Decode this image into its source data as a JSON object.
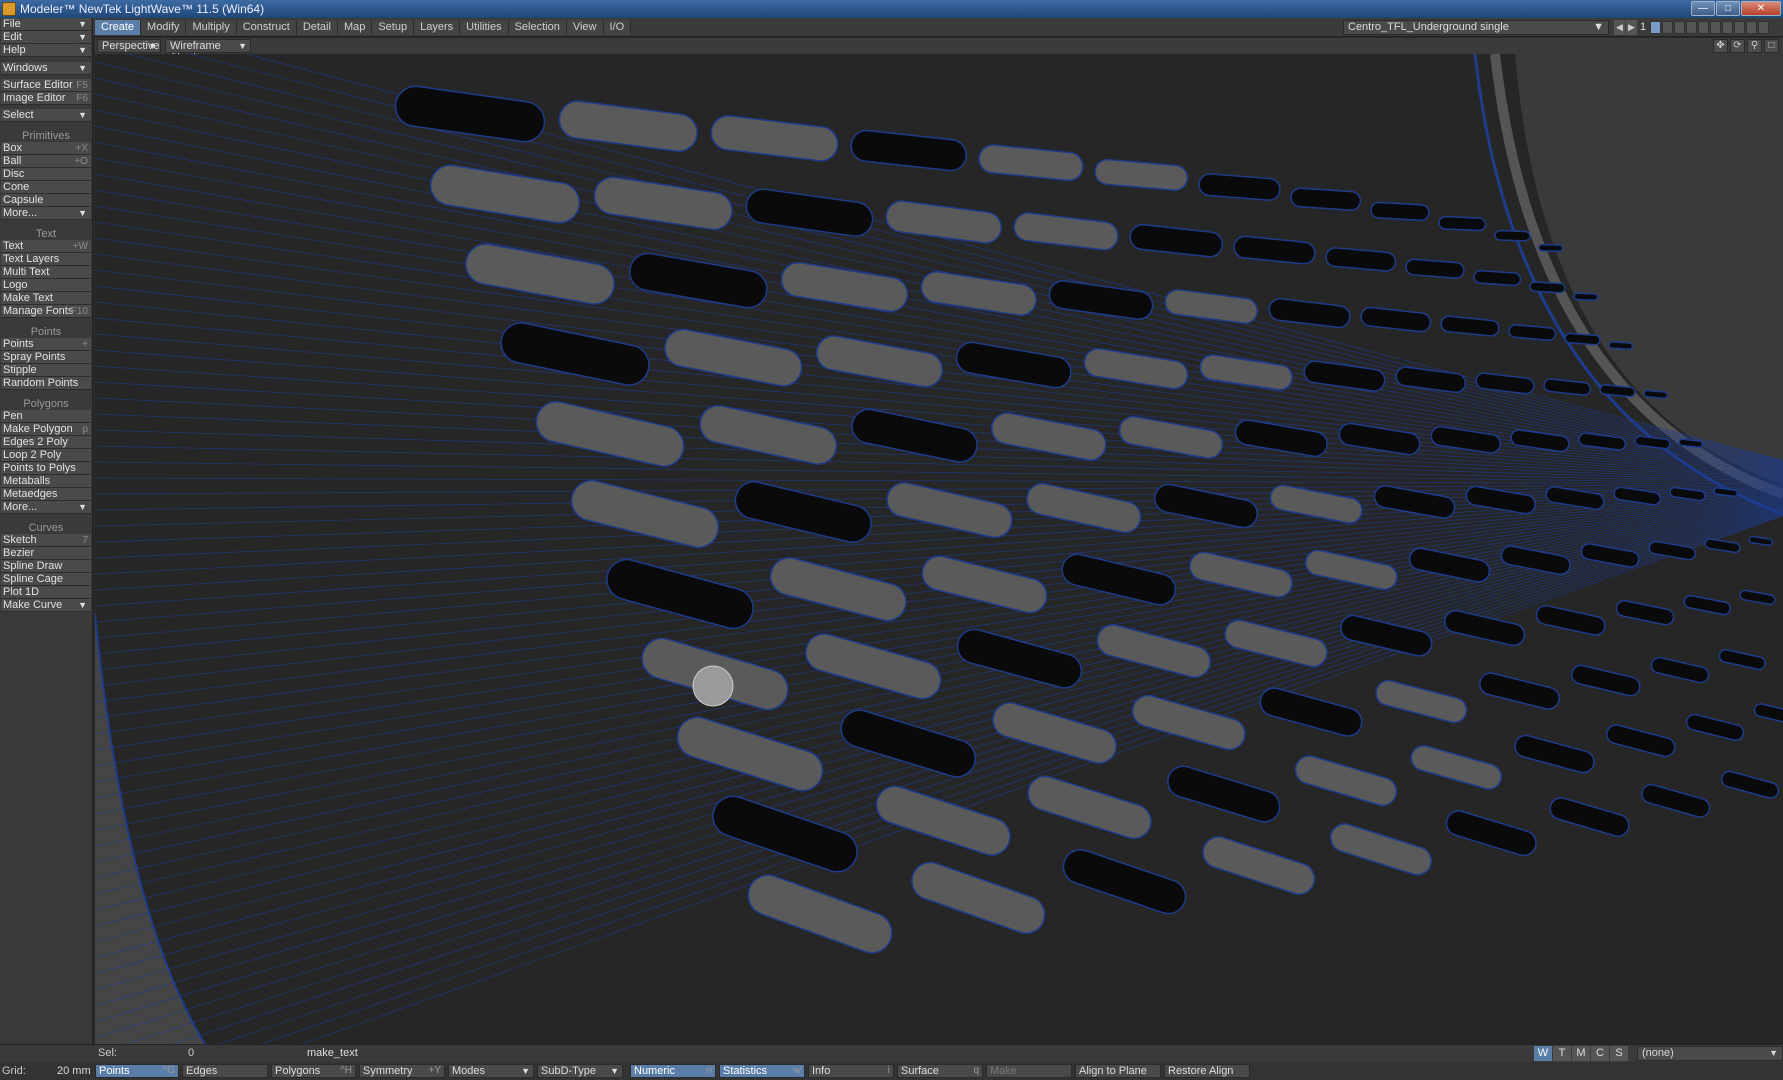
{
  "window": {
    "title": "Modeler™ NewTek LightWave™ 11.5 (Win64)"
  },
  "tabs": [
    "Create",
    "Modify",
    "Multiply",
    "Construct",
    "Detail",
    "Map",
    "Setup",
    "Layers",
    "Utilities",
    "Selection",
    "View",
    "I/O"
  ],
  "active_tab": "Create",
  "object_select": "Centro_TFL_Underground single",
  "layer_number": "1",
  "toolbar": {
    "file": "File",
    "edit": "Edit",
    "help": "Help",
    "windows": "Windows",
    "surface_editor": "Surface Editor",
    "surface_editor_key": "F5",
    "image_editor": "Image Editor",
    "image_editor_key": "F6",
    "select": "Select",
    "primitives_header": "Primitives",
    "box": "Box",
    "box_key": "+X",
    "ball": "Ball",
    "ball_key": "+O",
    "disc": "Disc",
    "cone": "Cone",
    "capsule": "Capsule",
    "more1": "More...",
    "text_header": "Text",
    "text": "Text",
    "text_key": "+W",
    "text_layers": "Text Layers",
    "multi_text": "Multi Text",
    "logo": "Logo",
    "make_text": "Make Text",
    "manage_fonts": "Manage Fonts",
    "manage_fonts_key": "F10",
    "points_header": "Points",
    "points": "Points",
    "points_key": "+",
    "spray_points": "Spray Points",
    "stipple": "Stipple",
    "random_points": "Random Points",
    "polygons_header": "Polygons",
    "pen": "Pen",
    "make_polygon": "Make Polygon",
    "make_polygon_key": "p",
    "edges_2_poly": "Edges 2 Poly",
    "loop_2_poly": "Loop 2 Poly",
    "points_to_polys": "Points to Polys",
    "metaballs": "Metaballs",
    "metaedges": "Metaedges",
    "more2": "More...",
    "curves_header": "Curves",
    "sketch": "Sketch",
    "sketch_key": "7",
    "bezier": "Bezier",
    "spline_draw": "Spline Draw",
    "spline_cage": "Spline Cage",
    "plot_1d": "Plot 1D",
    "make_curve": "Make Curve"
  },
  "viewport": {
    "view": "Perspective",
    "shading": "Wireframe Shade"
  },
  "status": {
    "sel_label": "Sel:",
    "sel_value": "0",
    "message": "make_text",
    "wtmcs": [
      "W",
      "T",
      "M",
      "C",
      "S"
    ],
    "surface_filter": "(none)"
  },
  "modes": {
    "grid_label": "Grid:",
    "grid_value": "20 mm",
    "points": "Points",
    "points_key": "^G",
    "edges": "Edges",
    "polygons": "Polygons",
    "polygons_key": "^H",
    "symmetry": "Symmetry",
    "symmetry_key": "+Y",
    "modes": "Modes",
    "subd_type": "SubD-Type",
    "numeric": "Numeric",
    "numeric_key": "n",
    "statistics": "Statistics",
    "statistics_key": "w",
    "info": "Info",
    "info_key": "i",
    "surface": "Surface",
    "surface_key": "q",
    "make": "Make",
    "align_to_plane": "Align to Plane",
    "restore_align": "Restore Align"
  },
  "colors": {
    "accent": "#5b7ea8",
    "wireframe": "#1e3c8c",
    "viewport_bg": "#262626",
    "surface": "#555555"
  }
}
